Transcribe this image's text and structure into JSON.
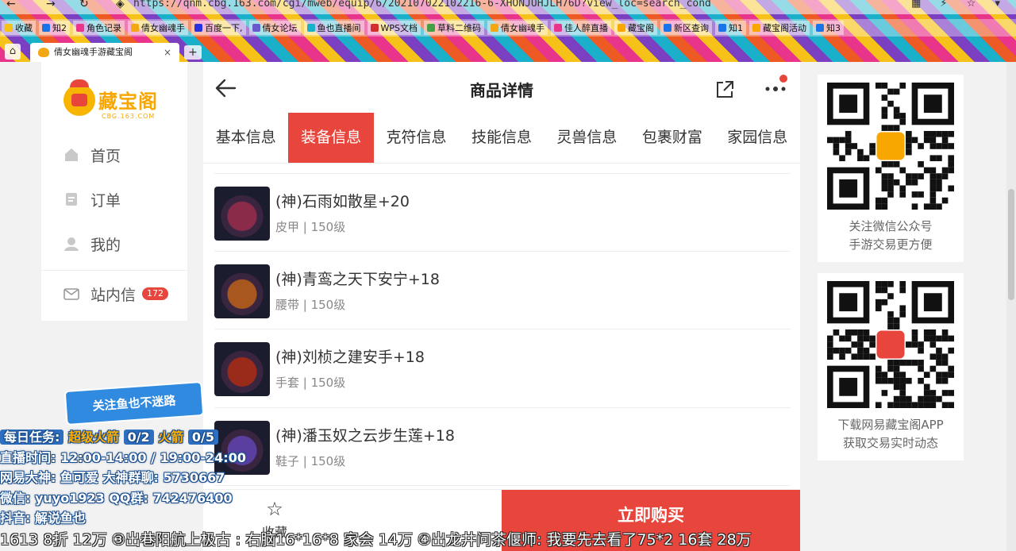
{
  "browser": {
    "url": "https://qnm.cbg.163.com/cgi/mweb/equip/6/202107022102216-6-XHONJUHJLH76D?view_loc=search_cond",
    "bookmarks": [
      {
        "label": "收藏",
        "color": "#f6c21a"
      },
      {
        "label": "知2",
        "color": "#1a73e8"
      },
      {
        "label": "角色记录",
        "color": "#e8358b"
      },
      {
        "label": "倩女幽魂手",
        "color": "#f3a712"
      },
      {
        "label": "百度一下,",
        "color": "#2932e1"
      },
      {
        "label": "倩女论坛",
        "color": "#6a5acd"
      },
      {
        "label": "鱼也直播间",
        "color": "#1ab0c9"
      },
      {
        "label": "WPS文档",
        "color": "#d32f2f"
      },
      {
        "label": "草料二维码",
        "color": "#43a047"
      },
      {
        "label": "倩女幽魂手",
        "color": "#f3a712"
      },
      {
        "label": "佳人醉直播",
        "color": "#e8358b"
      },
      {
        "label": "藏宝阁",
        "color": "#f7a700"
      },
      {
        "label": "新区查询",
        "color": "#1a73e8"
      },
      {
        "label": "知1",
        "color": "#1a73e8"
      },
      {
        "label": "藏宝阁活动",
        "color": "#f7a700"
      },
      {
        "label": "知3",
        "color": "#1a73e8"
      }
    ],
    "tab_title": "倩女幽魂手游藏宝阁",
    "tab_close": "×",
    "new_tab": "+"
  },
  "sidebar": {
    "logo_text": "藏宝阁",
    "logo_sub": "CBG.163.COM",
    "items": [
      {
        "label": "首页",
        "icon": "home-icon"
      },
      {
        "label": "订单",
        "icon": "order-icon"
      },
      {
        "label": "我的",
        "icon": "user-icon"
      },
      {
        "label": "站内信",
        "icon": "mail-icon",
        "badge": "172"
      }
    ]
  },
  "main": {
    "title": "商品详情",
    "tabs": [
      {
        "label": "基本信息",
        "active": false
      },
      {
        "label": "装备信息",
        "active": true
      },
      {
        "label": "克符信息",
        "active": false
      },
      {
        "label": "技能信息",
        "active": false
      },
      {
        "label": "灵兽信息",
        "active": false
      },
      {
        "label": "包裹财富",
        "active": false
      },
      {
        "label": "家园信息",
        "active": false
      }
    ],
    "items": [
      {
        "name": "(神)石雨如散星+20",
        "sub": "皮甲 | 150级"
      },
      {
        "name": "(神)青鸾之天下安宁+18",
        "sub": "腰带 | 150级"
      },
      {
        "name": "(神)刘桢之建安手+18",
        "sub": "手套 | 150级"
      },
      {
        "name": "(神)潘玉奴之云步生莲+18",
        "sub": "鞋子 | 150级"
      }
    ],
    "favorite_label": "收藏",
    "buy_label": "立即购买"
  },
  "qr": {
    "wechat_caption_1": "关注微信公众号",
    "wechat_caption_2": "手游交易更方便",
    "app_caption_1": "下载网易藏宝阁APP",
    "app_caption_2": "获取交易实时动态"
  },
  "overlay": {
    "banner": "关注鱼也不迷路",
    "task_label": "每日任务:",
    "task_1": "超级火箭",
    "task_1_count": "0/2",
    "task_2": "火箭",
    "task_2_count": "0/5",
    "live_time": "直播时间: 12:00-14:00 / 19:00-24:00",
    "god": "网易大神: 鱼可爱   大神群聊: 5730667",
    "wechat": "微信: yuyo1923   QQ群: 742476400",
    "douyin": "抖音: 解说鱼也",
    "ticker": "1613 8折 12万   ③出巷阳航上极古 : 右脑16*16*8 家会 14万   ④出龙井问茶偃师: 我要先去看了75*2 16套 28万"
  },
  "colors": {
    "accent": "#e8453c",
    "brand": "#f7a700"
  }
}
